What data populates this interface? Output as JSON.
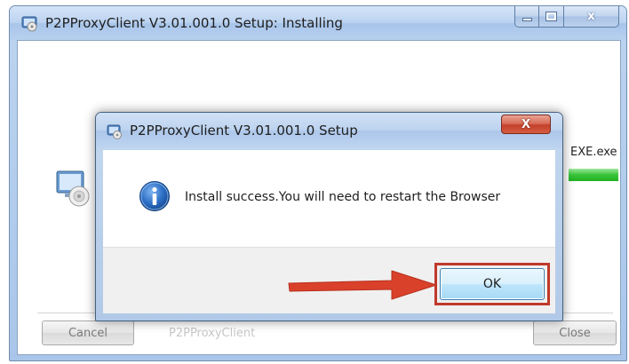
{
  "installer_window": {
    "title": "P2PProxyClient V3.01.001.0 Setup: Installing",
    "caption_buttons": {
      "minimize": "minimize",
      "maximize": "maximize",
      "close_glyph": "x"
    },
    "file_label": "EXE.exe",
    "progress_percent": 100,
    "brand_text": "P2PProxyClient",
    "cancel_label": "Cancel",
    "close_label": "Close"
  },
  "dialog": {
    "title": "P2PProxyClient V3.01.001.0 Setup",
    "close_glyph": "X",
    "message": "Install success.You will need to restart the Browser",
    "ok_label": "OK",
    "icon": "info-icon"
  },
  "annotation": {
    "arrow_color": "#d9412b",
    "highlight_color": "#c0392b",
    "arrow_icon": "red-arrow-icon"
  },
  "colors": {
    "progress_green": "#37c537",
    "titlebar_blue": "#bcd3f0",
    "close_red": "#c4402a"
  }
}
